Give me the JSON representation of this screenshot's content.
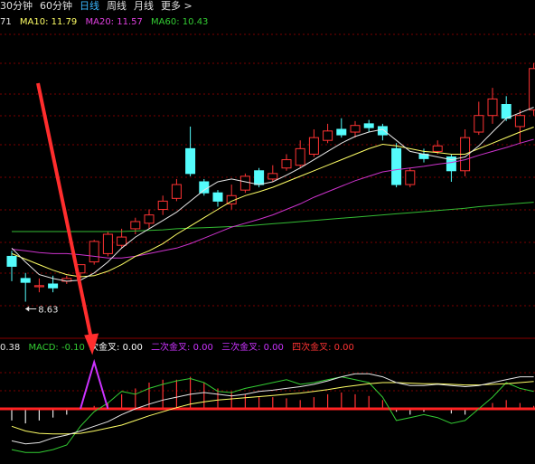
{
  "tabs": {
    "items": [
      {
        "label": "30分钟"
      },
      {
        "label": "60分钟"
      },
      {
        "label": "日线",
        "active": true
      },
      {
        "label": "周线"
      },
      {
        "label": "月线"
      },
      {
        "label": "更多 >"
      }
    ]
  },
  "ma_legend": {
    "ma5": {
      "text": "71",
      "color": "#e6e6e6"
    },
    "ma10": {
      "text": "MA10: 11.79",
      "color": "#ffff66"
    },
    "ma20": {
      "text": "MA20: 11.57",
      "color": "#e040e0"
    },
    "ma60": {
      "text": "MA60: 10.43",
      "color": "#33cc33"
    }
  },
  "macd_legend": {
    "dea": {
      "text": "0.38",
      "color": "#e6e6e6"
    },
    "macd": {
      "text": "MACD: -0.10",
      "color": "#33cc33"
    },
    "cross1": {
      "text": "次金叉: 0.00",
      "color": "#ffffff"
    },
    "cross2": {
      "text": "二次金叉: 0.00",
      "color": "#cc33ff"
    },
    "cross3": {
      "text": "三次金叉: 0.00",
      "color": "#cc33ff"
    },
    "cross4": {
      "text": "四次金叉: 0.00",
      "color": "#ff3333"
    }
  },
  "colors": {
    "up": "#ff3333",
    "down": "#54fcfc",
    "grid": "#7a0000",
    "ma5": "#e6e6e6",
    "ma10": "#ffff66",
    "ma20": "#cc33cc",
    "ma60": "#33bb33",
    "signal": "#ff3377",
    "macd_green": "#33cc33"
  },
  "annotations": {
    "low_price": "8.63"
  },
  "chart_data": {
    "type": "candlestick",
    "y_range": [
      8.0,
      13.6
    ],
    "candles": [
      {
        "o": 9.45,
        "h": 9.55,
        "c": 9.27,
        "l": 9.0
      },
      {
        "o": 9.05,
        "h": 9.15,
        "c": 8.98,
        "l": 8.63
      },
      {
        "o": 8.92,
        "h": 9.05,
        "c": 8.92,
        "l": 8.8
      },
      {
        "o": 8.95,
        "h": 9.1,
        "c": 8.88,
        "l": 8.8
      },
      {
        "o": 9.0,
        "h": 9.1,
        "c": 9.05,
        "l": 8.95
      },
      {
        "o": 9.15,
        "h": 9.3,
        "c": 9.3,
        "l": 9.05
      },
      {
        "o": 9.35,
        "h": 9.75,
        "c": 9.72,
        "l": 9.3
      },
      {
        "o": 9.5,
        "h": 9.9,
        "c": 9.85,
        "l": 9.45
      },
      {
        "o": 9.65,
        "h": 9.95,
        "c": 9.8,
        "l": 9.6
      },
      {
        "o": 9.95,
        "h": 10.15,
        "c": 10.08,
        "l": 9.85
      },
      {
        "o": 10.05,
        "h": 10.3,
        "c": 10.2,
        "l": 9.95
      },
      {
        "o": 10.3,
        "h": 10.55,
        "c": 10.45,
        "l": 10.2
      },
      {
        "o": 10.5,
        "h": 10.85,
        "c": 10.75,
        "l": 10.45
      },
      {
        "o": 11.4,
        "h": 11.8,
        "c": 10.95,
        "l": 10.9
      },
      {
        "o": 10.8,
        "h": 10.85,
        "c": 10.6,
        "l": 10.55
      },
      {
        "o": 10.6,
        "h": 10.65,
        "c": 10.45,
        "l": 10.35
      },
      {
        "o": 10.4,
        "h": 10.75,
        "c": 10.55,
        "l": 10.3
      },
      {
        "o": 10.65,
        "h": 10.95,
        "c": 10.9,
        "l": 10.6
      },
      {
        "o": 11.0,
        "h": 11.05,
        "c": 10.75,
        "l": 10.7
      },
      {
        "o": 10.85,
        "h": 11.1,
        "c": 10.95,
        "l": 10.8
      },
      {
        "o": 11.05,
        "h": 11.3,
        "c": 11.2,
        "l": 11.0
      },
      {
        "o": 11.1,
        "h": 11.55,
        "c": 11.4,
        "l": 11.05
      },
      {
        "o": 11.3,
        "h": 11.75,
        "c": 11.6,
        "l": 11.25
      },
      {
        "o": 11.55,
        "h": 11.85,
        "c": 11.72,
        "l": 11.5
      },
      {
        "o": 11.75,
        "h": 11.95,
        "c": 11.65,
        "l": 11.6
      },
      {
        "o": 11.7,
        "h": 11.9,
        "c": 11.82,
        "l": 11.6
      },
      {
        "o": 11.85,
        "h": 11.92,
        "c": 11.78,
        "l": 11.7
      },
      {
        "o": 11.8,
        "h": 11.85,
        "c": 11.65,
        "l": 11.55
      },
      {
        "o": 11.4,
        "h": 11.5,
        "c": 10.75,
        "l": 10.7
      },
      {
        "o": 10.75,
        "h": 11.05,
        "c": 11.0,
        "l": 10.7
      },
      {
        "o": 11.3,
        "h": 11.4,
        "c": 11.22,
        "l": 11.15
      },
      {
        "o": 11.35,
        "h": 11.55,
        "c": 11.45,
        "l": 11.3
      },
      {
        "o": 11.25,
        "h": 11.3,
        "c": 11.0,
        "l": 10.8
      },
      {
        "o": 11.0,
        "h": 11.75,
        "c": 11.6,
        "l": 10.9
      },
      {
        "o": 11.7,
        "h": 12.25,
        "c": 12.0,
        "l": 11.65
      },
      {
        "o": 12.0,
        "h": 12.5,
        "c": 12.3,
        "l": 11.85
      },
      {
        "o": 12.2,
        "h": 12.35,
        "c": 11.95,
        "l": 11.9
      },
      {
        "o": 11.8,
        "h": 12.1,
        "c": 12.0,
        "l": 11.5
      },
      {
        "o": 12.1,
        "h": 12.95,
        "c": 12.85,
        "l": 12.0
      }
    ],
    "ma5": [
      9.6,
      9.35,
      9.12,
      9.05,
      9.0,
      9.02,
      9.15,
      9.35,
      9.6,
      9.8,
      9.95,
      10.1,
      10.25,
      10.45,
      10.65,
      10.8,
      10.85,
      10.8,
      10.75,
      10.8,
      10.92,
      11.05,
      11.2,
      11.35,
      11.5,
      11.62,
      11.7,
      11.75,
      11.55,
      11.35,
      11.3,
      11.25,
      11.2,
      11.25,
      11.45,
      11.7,
      11.95,
      12.05,
      12.15
    ],
    "ma10": [
      9.5,
      9.4,
      9.3,
      9.2,
      9.12,
      9.08,
      9.1,
      9.18,
      9.3,
      9.45,
      9.55,
      9.68,
      9.85,
      10.0,
      10.15,
      10.3,
      10.45,
      10.55,
      10.62,
      10.7,
      10.8,
      10.9,
      11.0,
      11.1,
      11.2,
      11.3,
      11.4,
      11.48,
      11.45,
      11.4,
      11.35,
      11.33,
      11.3,
      11.3,
      11.4,
      11.5,
      11.6,
      11.7,
      11.79
    ],
    "ma20": [
      9.58,
      9.55,
      9.52,
      9.5,
      9.5,
      9.48,
      9.45,
      9.42,
      9.42,
      9.45,
      9.5,
      9.55,
      9.6,
      9.68,
      9.78,
      9.88,
      9.98,
      10.05,
      10.12,
      10.2,
      10.3,
      10.4,
      10.52,
      10.62,
      10.72,
      10.82,
      10.9,
      10.98,
      11.02,
      11.05,
      11.08,
      11.12,
      11.15,
      11.2,
      11.28,
      11.35,
      11.42,
      11.5,
      11.57
    ],
    "ma60": [
      9.9,
      9.9,
      9.9,
      9.9,
      9.9,
      9.9,
      9.9,
      9.9,
      9.9,
      9.91,
      9.92,
      9.93,
      9.95,
      9.96,
      9.97,
      9.98,
      9.99,
      10.0,
      10.02,
      10.04,
      10.06,
      10.08,
      10.1,
      10.12,
      10.14,
      10.16,
      10.18,
      10.2,
      10.22,
      10.24,
      10.26,
      10.28,
      10.3,
      10.32,
      10.35,
      10.37,
      10.39,
      10.41,
      10.43
    ],
    "macd_y_range": [
      -0.9,
      0.9
    ],
    "macd_bars": [
      -0.2,
      -0.25,
      -0.2,
      -0.15,
      -0.1,
      0.0,
      0.05,
      0.1,
      0.25,
      0.35,
      0.45,
      0.5,
      0.5,
      0.55,
      0.45,
      0.35,
      0.3,
      0.25,
      0.2,
      0.2,
      0.18,
      0.15,
      0.2,
      0.25,
      0.28,
      0.25,
      0.22,
      0.15,
      -0.05,
      -0.1,
      -0.05,
      -0.02,
      -0.08,
      -0.1,
      0.0,
      0.1,
      0.15,
      0.1,
      0.05
    ],
    "dif": [
      -0.55,
      -0.6,
      -0.58,
      -0.5,
      -0.45,
      -0.38,
      -0.3,
      -0.22,
      -0.1,
      0.0,
      0.08,
      0.15,
      0.2,
      0.25,
      0.28,
      0.25,
      0.22,
      0.25,
      0.3,
      0.32,
      0.35,
      0.38,
      0.42,
      0.48,
      0.55,
      0.6,
      0.6,
      0.55,
      0.45,
      0.4,
      0.4,
      0.42,
      0.4,
      0.38,
      0.4,
      0.45,
      0.5,
      0.55,
      0.55
    ],
    "dea": [
      -0.3,
      -0.38,
      -0.42,
      -0.43,
      -0.43,
      -0.42,
      -0.38,
      -0.33,
      -0.28,
      -0.2,
      -0.12,
      -0.05,
      0.02,
      0.08,
      0.12,
      0.15,
      0.17,
      0.19,
      0.21,
      0.23,
      0.25,
      0.27,
      0.3,
      0.33,
      0.37,
      0.4,
      0.43,
      0.45,
      0.45,
      0.44,
      0.43,
      0.43,
      0.42,
      0.41,
      0.41,
      0.42,
      0.43,
      0.45,
      0.47
    ],
    "macd_green_line": [
      -0.7,
      -0.75,
      -0.75,
      -0.7,
      -0.62,
      -0.3,
      -0.05,
      0.1,
      0.3,
      0.25,
      0.35,
      0.42,
      0.48,
      0.52,
      0.45,
      0.3,
      0.28,
      0.35,
      0.4,
      0.45,
      0.5,
      0.42,
      0.45,
      0.5,
      0.55,
      0.5,
      0.45,
      0.2,
      -0.2,
      -0.15,
      -0.1,
      -0.15,
      -0.25,
      -0.2,
      0.0,
      0.2,
      0.45,
      0.35,
      0.3
    ],
    "signal_peak": {
      "candle_index": 6,
      "value": 0.8
    }
  }
}
